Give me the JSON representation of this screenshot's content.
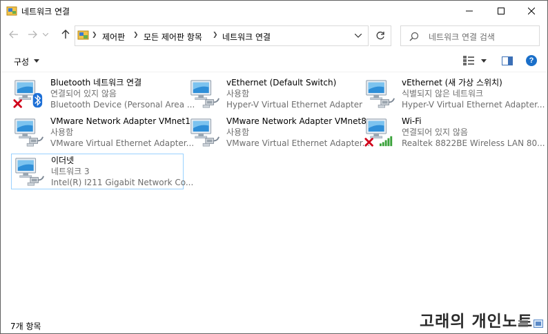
{
  "window": {
    "title": "네트워크 연결",
    "controls": {
      "minimize": "—",
      "maximize": "☐",
      "close": "✕"
    }
  },
  "nav": {
    "back_icon": "arrow-left-icon",
    "forward_icon": "arrow-right-icon",
    "recent_icon": "chevron-down-icon",
    "up_icon": "arrow-up-icon",
    "breadcrumb": [
      "제어판",
      "모든 제어판 항목",
      "네트워크 연결"
    ],
    "search_placeholder": "네트워크 연결 검색"
  },
  "toolbar": {
    "organize_label": "구성",
    "help_label": "?"
  },
  "items": [
    {
      "name": "Bluetooth 네트워크 연결",
      "status": "연결되어 있지 않음",
      "device": "Bluetooth Device (Personal Area ...",
      "overlay": "bluetooth",
      "disconnected": true
    },
    {
      "name": "vEthernet (Default Switch)",
      "status": "사용함",
      "device": "Hyper-V Virtual Ethernet Adapter",
      "overlay": "cable",
      "disconnected": false
    },
    {
      "name": "vEthernet (새 가상 스위치)",
      "status": "식별되지 않은 네트워크",
      "device": "Hyper-V Virtual Ethernet Adapter...",
      "overlay": "cable",
      "disconnected": false
    },
    {
      "name": "VMware Network Adapter VMnet1",
      "status": "사용함",
      "device": "VMware Virtual Ethernet Adapter...",
      "overlay": "cable",
      "disconnected": false
    },
    {
      "name": "VMware Network Adapter VMnet8",
      "status": "사용함",
      "device": "VMware Virtual Ethernet Adapter...",
      "overlay": "cable",
      "disconnected": false
    },
    {
      "name": "Wi-Fi",
      "status": "연결되어 있지 않음",
      "device": "Realtek 8822BE Wireless LAN 80...",
      "overlay": "wifi",
      "disconnected": true
    },
    {
      "name": "이더넷",
      "status": "네트워크 3",
      "device": "Intel(R) I211 Gigabit Network Co...",
      "overlay": "cable",
      "disconnected": false,
      "selected": true
    }
  ],
  "statusbar": {
    "count": "7개 항목",
    "watermark": "고래의 개인노트"
  },
  "colors": {
    "accent": "#1a6fc9",
    "selection_border": "#99d1ff",
    "disconnect_red": "#d0021b",
    "wifi_green": "#3aa23a"
  }
}
